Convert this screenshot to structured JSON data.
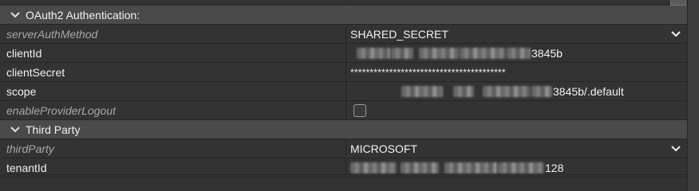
{
  "groups": {
    "oauth": {
      "label": "OAuth2 Authentication:"
    },
    "third_party": {
      "label": "Third Party"
    }
  },
  "rows": {
    "serverAuthMethod": {
      "name": "serverAuthMethod",
      "value": "SHARED_SECRET"
    },
    "clientId": {
      "name": "clientId",
      "value_suffix": "3845b"
    },
    "clientSecret": {
      "name": "clientSecret",
      "value": "****************************************"
    },
    "scope": {
      "name": "scope",
      "value_suffix": "3845b/.default"
    },
    "enableProviderLogout": {
      "name": "enableProviderLogout",
      "checked": false
    },
    "thirdParty": {
      "name": "thirdParty",
      "value": "MICROSOFT"
    },
    "tenantId": {
      "name": "tenantId",
      "value_suffix": "128"
    }
  },
  "icons": {
    "group_toggle": "chevron-down-icon",
    "dropdown": "chevron-down-icon"
  },
  "colors": {
    "background": "#333333",
    "group_header": "#4a4a4a",
    "text": "#f2f2f2",
    "disabled_text": "#a8a8a8"
  }
}
